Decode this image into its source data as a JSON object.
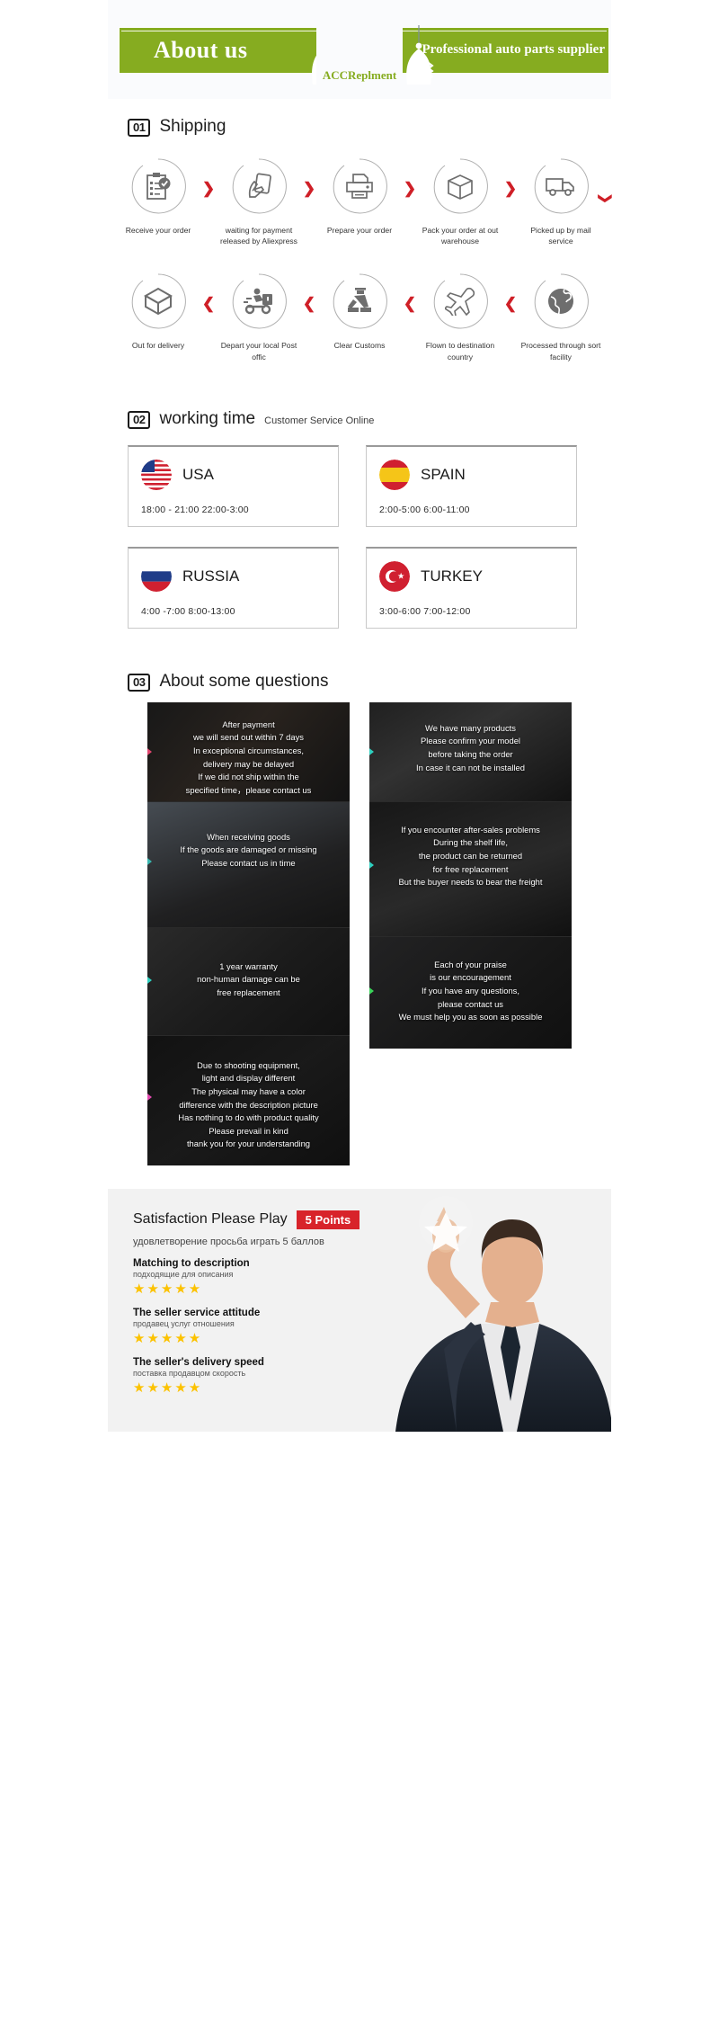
{
  "header": {
    "about_title": "About us",
    "logo_text": "ACCReplment",
    "supplier_title": "Professional auto parts supplier",
    "green": "#86ac20"
  },
  "shipping": {
    "number": "01",
    "title": "Shipping",
    "row1": [
      {
        "label": "Receive your order",
        "icon": "clipboard-check-icon"
      },
      {
        "label": "waiting for payment\nreleased by Aliexpress",
        "icon": "hand-card-icon"
      },
      {
        "label": "Prepare your order",
        "icon": "printer-icon"
      },
      {
        "label": "Pack your order at\nout warehouse",
        "icon": "box-icon"
      },
      {
        "label": "Picked up by\nmail service",
        "icon": "truck-icon"
      }
    ],
    "row2": [
      {
        "label": "Out  for delivery",
        "icon": "open-box-icon"
      },
      {
        "label": "Depart your local\nPost offic",
        "icon": "scooter-delivery-icon"
      },
      {
        "label": "Clear Customs",
        "icon": "customs-officer-icon"
      },
      {
        "label": "Flown to\ndestination country",
        "icon": "airplane-icon"
      },
      {
        "label": "Processed through\nsort facility",
        "icon": "globe-icon"
      }
    ],
    "chevron_right": "❯",
    "chevron_left": "❮",
    "chevron_down": "❯"
  },
  "working_time": {
    "number": "02",
    "title": "working time",
    "subtitle": "Customer Service Online",
    "cards": [
      {
        "country": "USA",
        "hours": "18:00 - 21:00   22:00-3:00",
        "flag": "flag-usa"
      },
      {
        "country": "SPAIN",
        "hours": "2:00-5:00     6:00-11:00",
        "flag": "flag-spain"
      },
      {
        "country": "RUSSIA",
        "hours": "4:00 -7:00   8:00-13:00",
        "flag": "flag-russia"
      },
      {
        "country": "TURKEY",
        "hours": "3:00-6:00    7:00-12:00",
        "flag": "flag-turkey"
      }
    ]
  },
  "questions": {
    "number": "03",
    "title": "About some questions",
    "left_panels": [
      "After payment\nwe will send out within 7 days\nIn exceptional circumstances,\ndelivery may be delayed\nIf we did not ship within the\nspecified time，please contact us",
      "When receiving goods\nIf the goods are damaged or missing\nPlease contact us in time",
      "1 year warranty\nnon-human damage can be\nfree replacement",
      "Due to shooting equipment,\nlight and display different\nThe physical may have a color\ndifference with the description picture\nHas nothing to do with product quality\nPlease prevail in kind\nthank you for your understanding"
    ],
    "right_panels": [
      "We have many products\nPlease confirm your model\nbefore taking the order\nIn case it can not be installed",
      "If you encounter after-sales problems\nDuring the shelf life,\nthe product can be returned\nfor free replacement\nBut the buyer needs to bear the freight",
      "Each of your praise\nis our encouragement\nIf you have any questions,\nplease contact us\nWe must help you as soon as possible"
    ]
  },
  "rating": {
    "headline": "Satisfaction Please Play",
    "points_badge": "5 Points",
    "subline": "удовлетворение просьба играть 5 баллов",
    "items": [
      {
        "en": "Matching to description",
        "ru": "подходящие для описания",
        "stars": "★★★★★"
      },
      {
        "en": "The seller service attitude",
        "ru": "продавец услуг отношения",
        "stars": "★★★★★"
      },
      {
        "en": "The seller's delivery speed",
        "ru": "поставка продавцом скорость",
        "stars": "★★★★★"
      }
    ],
    "badge_color": "#d8232a",
    "star_color": "#fcc200"
  }
}
